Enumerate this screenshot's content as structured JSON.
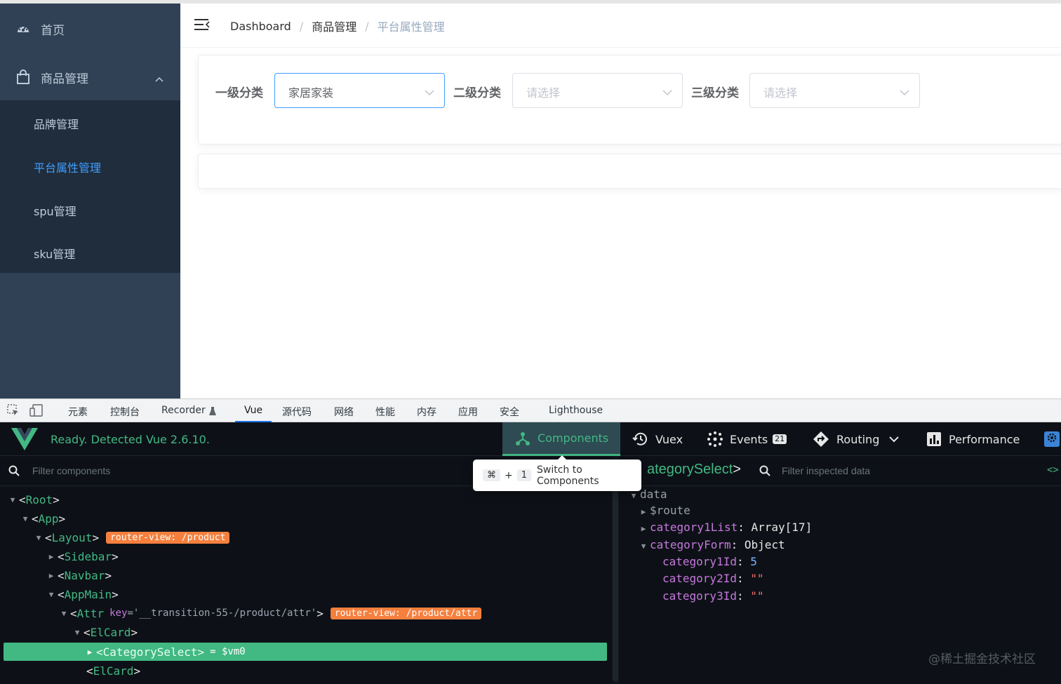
{
  "sidebar": {
    "home_label": "首页",
    "goods_label": "商品管理",
    "sub_items": [
      "品牌管理",
      "平台属性管理",
      "spu管理",
      "sku管理"
    ],
    "active_index": 1,
    "colors": {
      "bg": "#304156",
      "submenu_bg": "#1f2d3d",
      "active": "#409eff"
    }
  },
  "breadcrumb": {
    "home": "Dashboard",
    "sep": "/",
    "mid": "商品管理",
    "current": "平台属性管理"
  },
  "form": {
    "level1": {
      "label": "一级分类",
      "value": "家居家装"
    },
    "level2": {
      "label": "二级分类",
      "placeholder": "请选择"
    },
    "level3": {
      "label": "三级分类",
      "placeholder": "请选择"
    }
  },
  "devtools": {
    "tabs": [
      "元素",
      "控制台",
      "Recorder",
      "Vue",
      "源代码",
      "网络",
      "性能",
      "内存",
      "应用",
      "安全",
      "Lighthouse"
    ],
    "active_tab": "Vue"
  },
  "vue": {
    "status": "Ready. Detected Vue 2.6.10.",
    "tabs": {
      "components": "Components",
      "vuex": "Vuex",
      "events": "Events",
      "events_count": "21",
      "routing": "Routing",
      "performance": "Performance"
    },
    "filter_placeholder": "Filter components",
    "tooltip": {
      "key1": "⌘",
      "plus": "+",
      "key2": "1",
      "text": "Switch to Components"
    },
    "tree": {
      "root": "Root",
      "app": "App",
      "layout": "Layout",
      "layout_chip": "router-view: /product",
      "sidebar": "Sidebar",
      "navbar": "Navbar",
      "appmain": "AppMain",
      "attr": "Attr",
      "attr_key_name": "key",
      "attr_key_value": "='__transition-55-/product/attr'",
      "attr_chip": "router-view: /product/attr",
      "elcard": "ElCard",
      "selected": "CategorySelect",
      "selected_suffix": "= $vm0",
      "elcard2": "ElCard"
    },
    "inspector": {
      "title": "ategorySelect",
      "filter_placeholder": "Filter inspected data",
      "code_icon": "<>",
      "section": "data",
      "route_key": "$route",
      "list_key": "category1List",
      "list_val": "Array[17]",
      "form_key": "categoryForm",
      "form_val": "Object",
      "c1_key": "category1Id",
      "c1_val": "5",
      "c2_key": "category2Id",
      "c2_val": "\"\"",
      "c3_key": "category3Id",
      "c3_val": "\"\""
    },
    "accent": "#42b883"
  },
  "watermark": "@稀土掘金技术社区"
}
